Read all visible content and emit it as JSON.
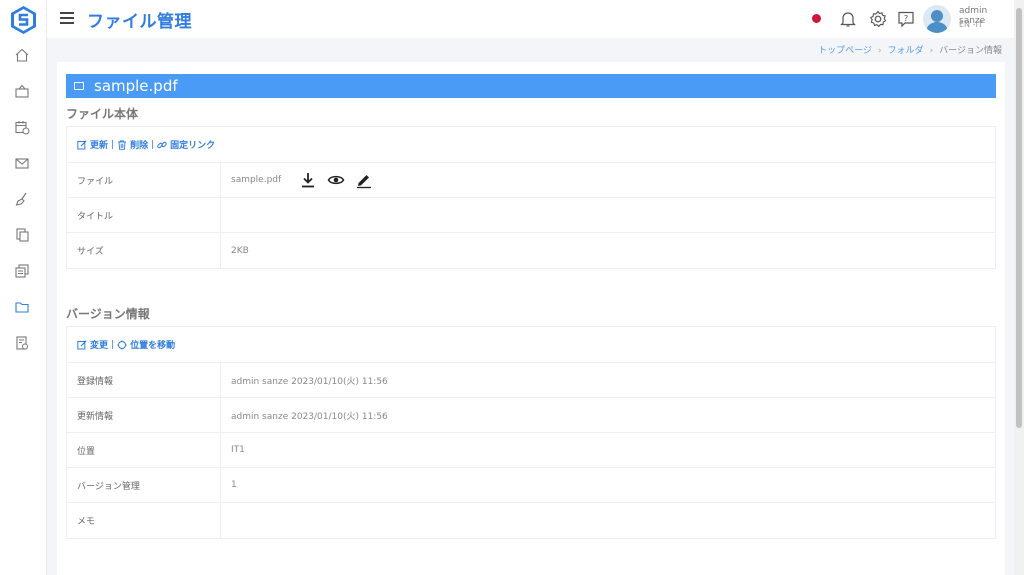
{
  "app": {
    "title": "ファイル管理",
    "accent": "#2f7de1",
    "header_blue": "#4a9bf5"
  },
  "sidebar": {
    "items": [
      {
        "icon": "home-icon"
      },
      {
        "icon": "briefcase-icon"
      },
      {
        "icon": "calendar-icon"
      },
      {
        "icon": "mail-icon"
      },
      {
        "icon": "broom-icon"
      },
      {
        "icon": "documents-icon"
      },
      {
        "icon": "stacked-documents-icon"
      },
      {
        "icon": "folder-icon"
      },
      {
        "icon": "document-settings-icon"
      }
    ]
  },
  "topbar": {
    "user_name": "admin sanze",
    "user_lang": "EN -IT"
  },
  "breadcrumb": {
    "items": [
      "トップページ",
      "フォルダ",
      "バージョン情報"
    ]
  },
  "file": {
    "name": "sample.pdf"
  },
  "file_section": {
    "title": "ファイル本体",
    "actions": {
      "update": "更新",
      "delete": "削除",
      "permalink": "固定リンク"
    },
    "rows": [
      {
        "label": "ファイル",
        "value": "sample.pdf"
      },
      {
        "label": "タイトル",
        "value": ""
      },
      {
        "label": "サイズ",
        "value": "2KB"
      }
    ]
  },
  "version_section": {
    "title": "バージョン情報",
    "actions": {
      "change": "変更",
      "move": "位置を移動"
    },
    "rows": [
      {
        "label": "登録情報",
        "value": "admin sanze 2023/01/10(火) 11:56"
      },
      {
        "label": "更新情報",
        "value": "admin sanze 2023/01/10(火) 11:56"
      },
      {
        "label": "位置",
        "value": "IT1"
      },
      {
        "label": "バージョン管理",
        "value": "1"
      },
      {
        "label": "メモ",
        "value": ""
      }
    ]
  }
}
